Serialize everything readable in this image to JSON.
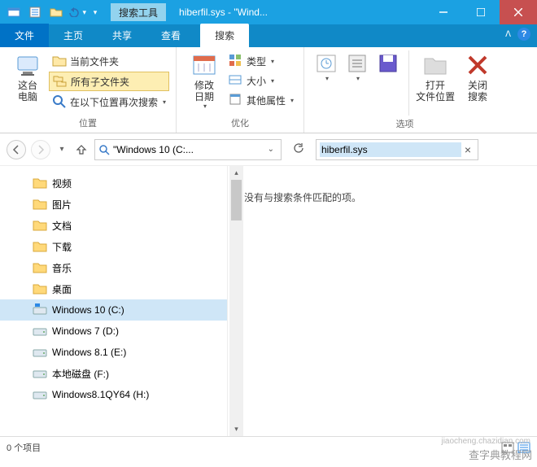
{
  "titlebar": {
    "context_tab": "搜索工具",
    "title": "hiberfil.sys - \"Wind..."
  },
  "tabs": {
    "file": "文件",
    "home": "主页",
    "share": "共享",
    "view": "查看",
    "search": "搜索"
  },
  "ribbon": {
    "location": {
      "this_pc": "这台\n电脑",
      "current_folder": "当前文件夹",
      "all_subfolders": "所有子文件夹",
      "search_again": "在以下位置再次搜索",
      "group_label": "位置"
    },
    "refine": {
      "mod_date": "修改\n日期",
      "kind": "类型",
      "size": "大小",
      "other": "其他属性",
      "group_label": "优化"
    },
    "options": {
      "open_location": "打开\n文件位置",
      "close_search": "关闭\n搜索",
      "group_label": "选项"
    }
  },
  "nav": {
    "address": "\"Windows 10 (C:...",
    "search_value": "hiberfil.sys"
  },
  "tree": {
    "items": [
      {
        "label": "视频",
        "icon": "folder-orange"
      },
      {
        "label": "图片",
        "icon": "folder-orange"
      },
      {
        "label": "文档",
        "icon": "folder-orange"
      },
      {
        "label": "下载",
        "icon": "folder-orange"
      },
      {
        "label": "音乐",
        "icon": "folder-orange"
      },
      {
        "label": "桌面",
        "icon": "folder-orange"
      },
      {
        "label": "Windows 10 (C:)",
        "icon": "drive-os",
        "selected": true
      },
      {
        "label": "Windows 7 (D:)",
        "icon": "drive"
      },
      {
        "label": "Windows 8.1 (E:)",
        "icon": "drive"
      },
      {
        "label": "本地磁盘 (F:)",
        "icon": "drive"
      },
      {
        "label": "Windows8.1QY64 (H:)",
        "icon": "drive"
      }
    ]
  },
  "results": {
    "empty_msg": "没有与搜索条件匹配的项。"
  },
  "status": {
    "count": "0 个项目"
  },
  "watermark": {
    "main": "查字典教程网",
    "sub": "jiaocheng.chazidian.com"
  }
}
